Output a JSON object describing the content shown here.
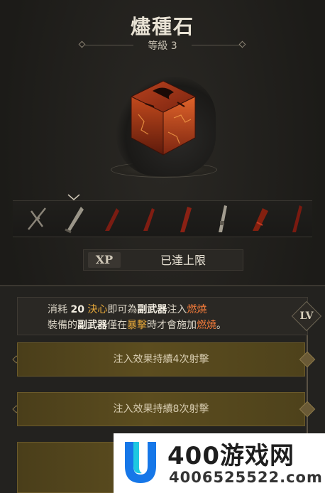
{
  "item": {
    "name": "燼種石",
    "rank_label": "等級 3"
  },
  "xp": {
    "icon_label": "XP",
    "status": "已達上限"
  },
  "description": {
    "line1_prefix": "消耗 ",
    "cost": "20",
    "resource": "決心",
    "line1_mid": "即可為",
    "target": "副武器",
    "line1_mid2": "注入",
    "effect": "燃燒",
    "line2_prefix": "裝備的",
    "target2": "副武器",
    "line2_mid": "僅在",
    "condition": "暴擊",
    "line2_mid2": "時才會施加",
    "effect2": "燃燒",
    "line2_end": "。"
  },
  "level_badge": "LV",
  "tiers": [
    {
      "label": "注入效果持續4次射擊"
    },
    {
      "label": "注入效果持續8次射擊"
    }
  ],
  "weapon_slots": [
    {
      "icon": "crossbow-icon",
      "selected": false
    },
    {
      "icon": "blade-icon",
      "selected": true
    },
    {
      "icon": "red-dagger-icon",
      "selected": false
    },
    {
      "icon": "red-dagger-icon",
      "selected": false
    },
    {
      "icon": "red-dagger-icon",
      "selected": false
    },
    {
      "icon": "rifle-icon",
      "selected": false
    },
    {
      "icon": "red-cleaver-icon",
      "selected": false
    },
    {
      "icon": "red-spike-icon",
      "selected": false
    }
  ],
  "watermark": {
    "brand": "400游戏网",
    "phone": "4006525522.com"
  },
  "colors": {
    "highlight_gold": "#e8a93a",
    "burn_orange": "#f07a3a",
    "tier_gold": "#5c4d1f"
  }
}
